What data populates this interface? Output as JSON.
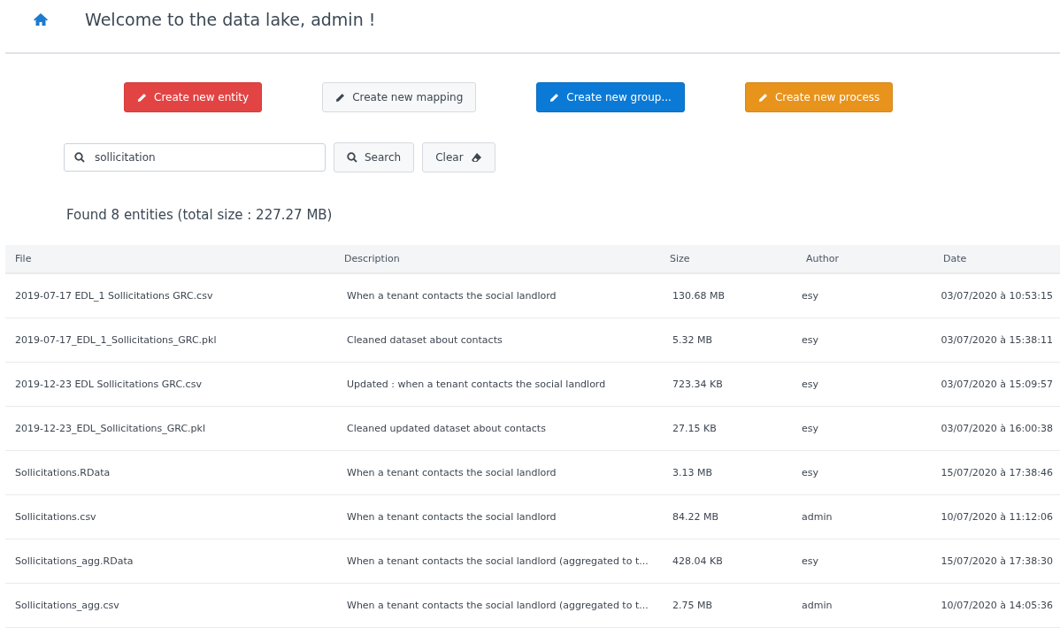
{
  "header": {
    "title": "Welcome to the data lake, admin !"
  },
  "actions": [
    {
      "label": "Create new entity",
      "kind": "danger"
    },
    {
      "label": "Create new mapping",
      "kind": "default"
    },
    {
      "label": "Create new group...",
      "kind": "primary"
    },
    {
      "label": "Create new process",
      "kind": "warning"
    }
  ],
  "search": {
    "value": "sollicitation",
    "search_button": "Search",
    "clear_button": "Clear"
  },
  "summary": "Found 8 entities (total size : 227.27 MB)",
  "table": {
    "columns": [
      "File",
      "Description",
      "Size",
      "Author",
      "Date"
    ],
    "rows": [
      [
        "2019-07-17 EDL_1 Sollicitations GRC.csv",
        "When a tenant contacts the social landlord",
        "130.68 MB",
        "esy",
        "03/07/2020 à 10:53:15"
      ],
      [
        "2019-07-17_EDL_1_Sollicitations_GRC.pkl",
        "Cleaned dataset about contacts",
        "5.32 MB",
        "esy",
        "03/07/2020 à 15:38:11"
      ],
      [
        "2019-12-23 EDL Sollicitations GRC.csv",
        "Updated : when a tenant contacts the social landlord",
        "723.34 KB",
        "esy",
        "03/07/2020 à 15:09:57"
      ],
      [
        "2019-12-23_EDL_Sollicitations_GRC.pkl",
        "Cleaned updated dataset about contacts",
        "27.15 KB",
        "esy",
        "03/07/2020 à 16:00:38"
      ],
      [
        "Sollicitations.RData",
        "When a tenant contacts the social landlord",
        "3.13 MB",
        "esy",
        "15/07/2020 à 17:38:46"
      ],
      [
        "Sollicitations.csv",
        "When a tenant contacts the social landlord",
        "84.22 MB",
        "admin",
        "10/07/2020 à 11:12:06"
      ],
      [
        "Sollicitations_agg.RData",
        "When a tenant contacts the social landlord (aggregated to t...",
        "428.04 KB",
        "esy",
        "15/07/2020 à 17:38:30"
      ],
      [
        "Sollicitations_agg.csv",
        "When a tenant contacts the social landlord (aggregated to t...",
        "2.75 MB",
        "admin",
        "10/07/2020 à 14:05:36"
      ]
    ]
  }
}
